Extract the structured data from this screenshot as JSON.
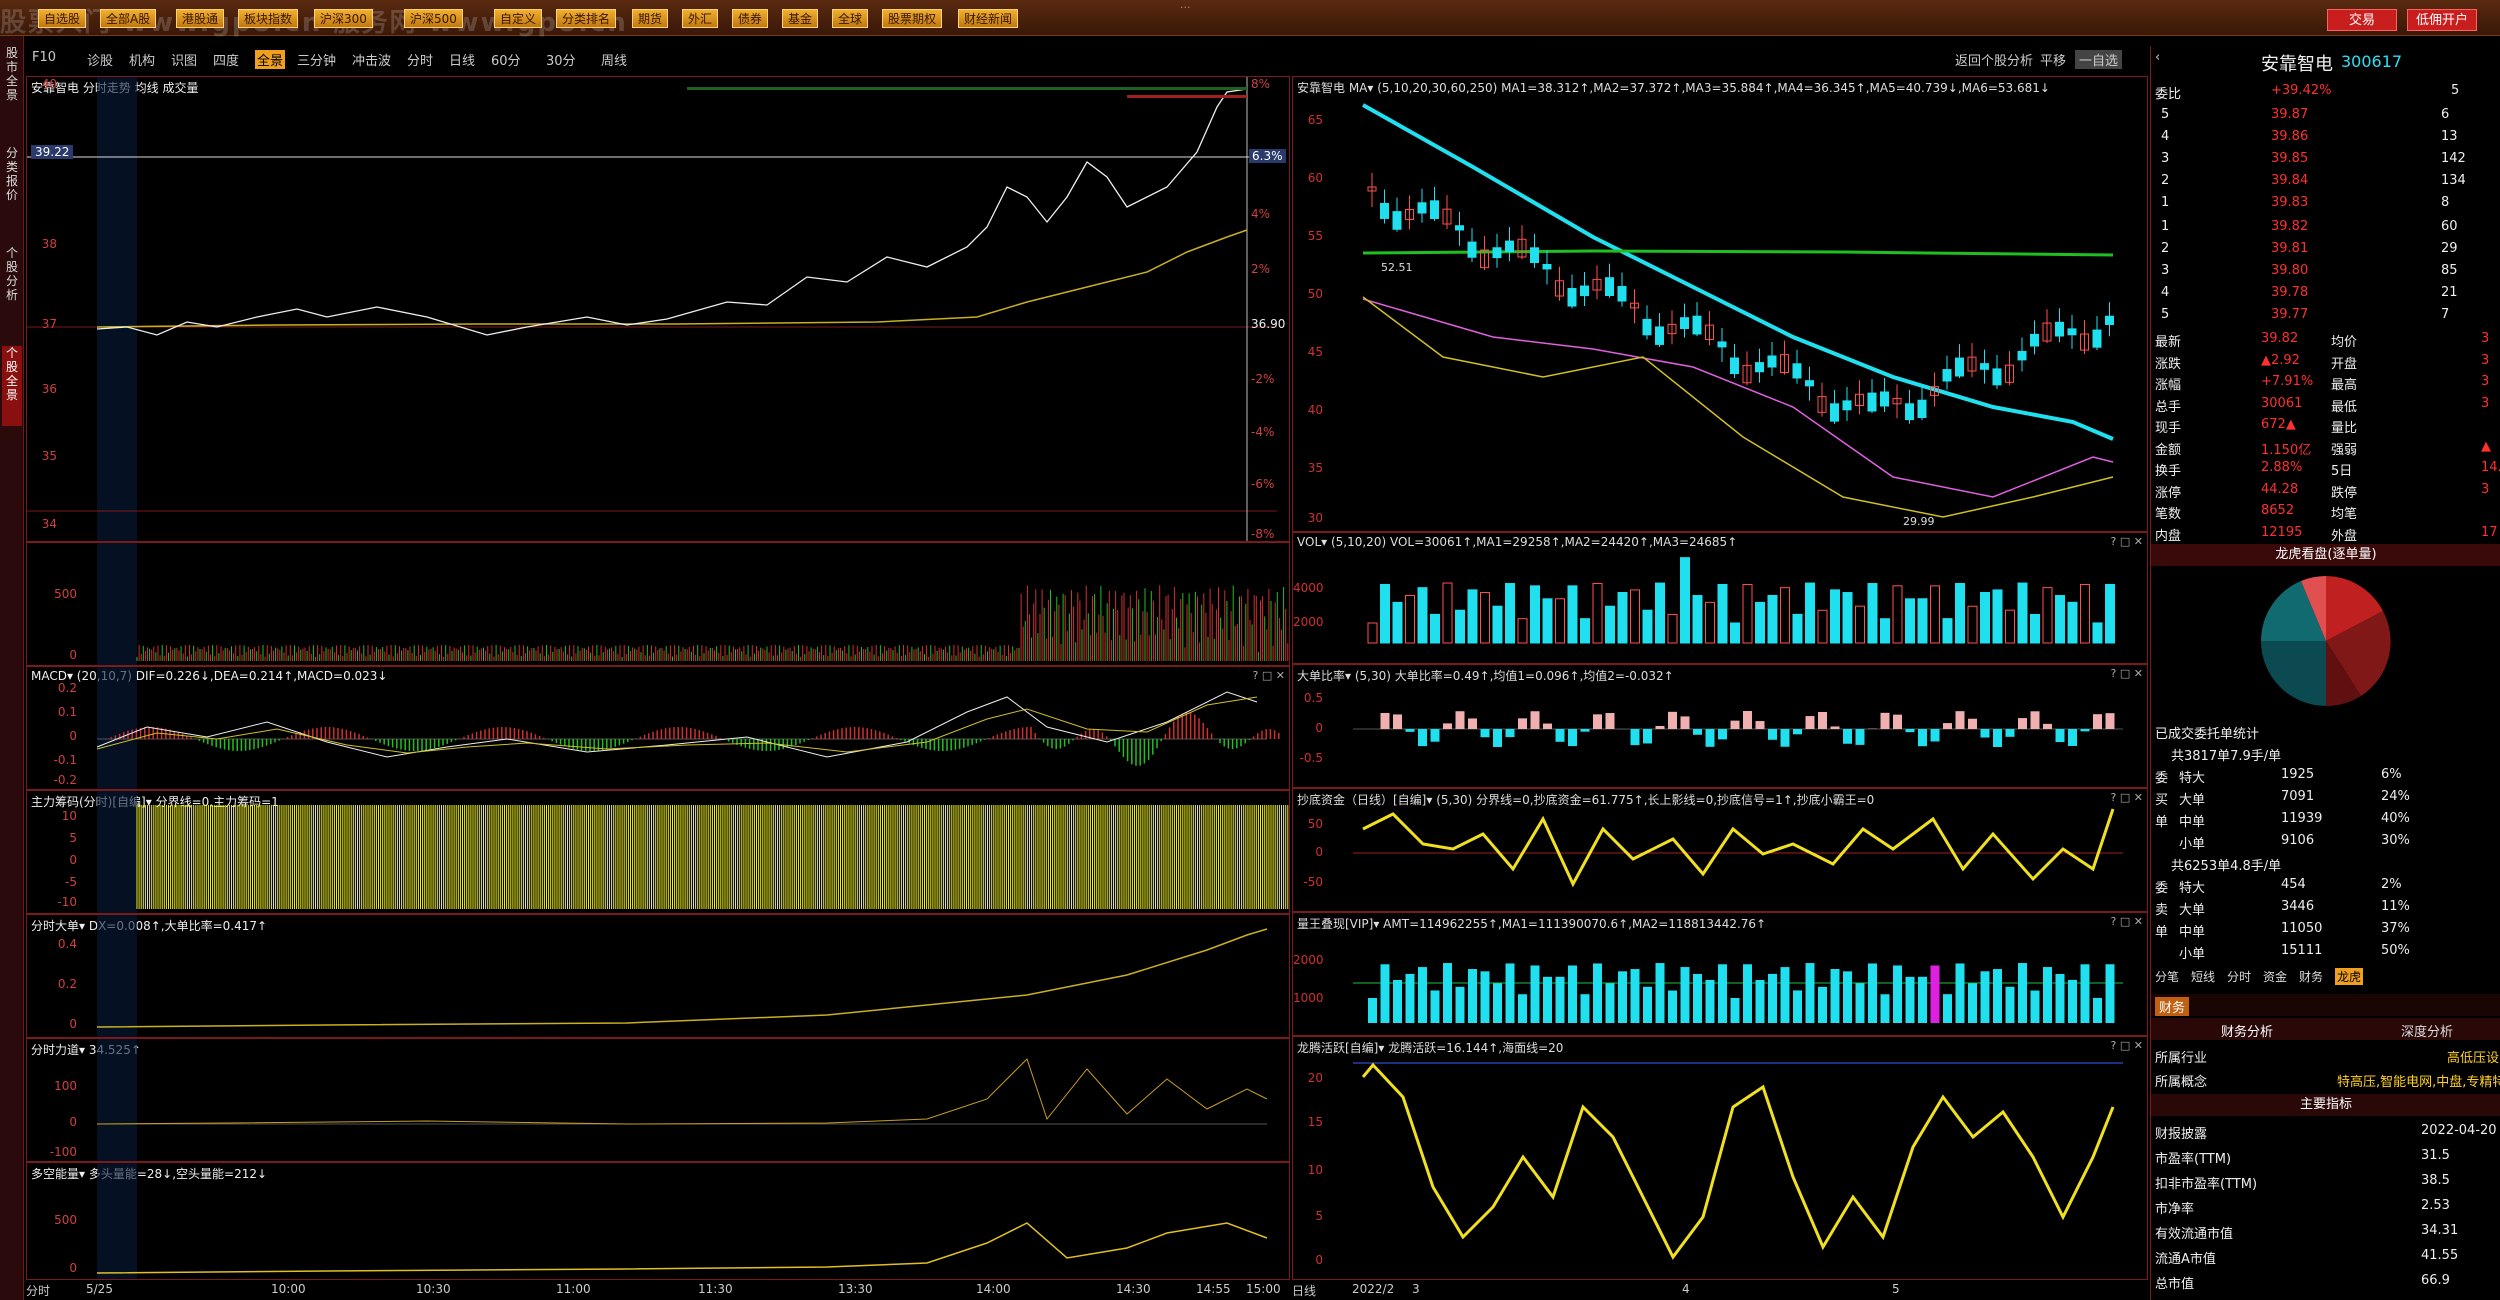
{
  "watermark": "股票入门 www.gp8.cn  服务网 www.gp8.cn",
  "window_title": "...",
  "toolbar": {
    "buttons": [
      "自选股",
      "全部A股",
      "港股通",
      "板块指数",
      "沪深300",
      "沪深500",
      "自定义",
      "分类排名",
      "期货",
      "外汇",
      "债券",
      "基金",
      "全球",
      "股票期权",
      "财经新闻"
    ],
    "trade_label": "交易",
    "account_label": "低佣开户"
  },
  "left_tabs": [
    {
      "label": "股市全景",
      "selected": false
    },
    {
      "label": "分类报价",
      "selected": false
    },
    {
      "label": "个股分析",
      "selected": false
    },
    {
      "label": "个股全景",
      "selected": true
    }
  ],
  "menubar": {
    "items": [
      "F10",
      "诊股",
      "机构",
      "识图",
      "四度",
      "全景",
      "三分钟",
      "冲击波",
      "分时",
      "日线",
      "60分",
      "30分",
      "周线"
    ],
    "active": "全景",
    "right_items": [
      "返回个股分析",
      "平移",
      "一自选"
    ]
  },
  "intraday": {
    "title": "安靠智电  分时走势  均线  成交量",
    "prices": [
      "40",
      "39",
      "38",
      "37",
      "36",
      "35",
      "34"
    ],
    "current_price": "39.22",
    "pct": [
      "8%",
      "6.3%",
      "4%",
      "2%",
      "36.90",
      "-2%",
      "-4%",
      "-6%",
      "-8%"
    ],
    "vol_ticks": [
      "500",
      "0"
    ],
    "macd_title": "MACD▾  (20,10,7)  DIF=0.226↓,DEA=0.214↑,MACD=0.023↓",
    "macd_ticks": [
      "0.2",
      "0.1",
      "0",
      "-0.1",
      "-0.2"
    ],
    "chip_title": "主力筹码(分时)[自编]▾  分界线=0,主力筹码=1",
    "chip_ticks": [
      "10",
      "5",
      "0",
      "-5",
      "-10"
    ],
    "bigorder_title": "分时大单▾  DX=0.008↑,大单比率=0.417↑",
    "bigorder_ticks": [
      "0.4",
      "0.2",
      "0"
    ],
    "power_title": "分时力道▾  34.525↑",
    "power_ticks": [
      "100",
      "0",
      "-100"
    ],
    "energy_title": "多空能量▾  多头量能=28↓,空头量能=212↓",
    "energy_ticks": [
      "500",
      "0"
    ],
    "time_axis": [
      "分时",
      "5/25",
      "10:00",
      "10:30",
      "11:00",
      "11:30",
      "13:30",
      "14:00",
      "14:30",
      "14:55",
      "15:00"
    ]
  },
  "daily": {
    "title": "安靠智电  MA▾  (5,10,20,30,60,250)  MA1=38.312↑,MA2=37.372↑,MA3=35.884↑,MA4=36.345↑,MA5=40.739↓,MA6=53.681↓",
    "price_ticks": [
      "65",
      "60",
      "55",
      "50",
      "45",
      "40",
      "35",
      "30"
    ],
    "hi_label": "52.51",
    "lo_label": "29.99",
    "vol_title": "VOL▾  (5,10,20)  VOL=30061↑,MA1=29258↑,MA2=24420↑,MA3=24685↑",
    "vol_ticks": [
      "4000",
      "2000"
    ],
    "ratio_title": "大单比率▾  (5,30)  大单比率=0.49↑,均值1=0.096↑,均值2=-0.032↑",
    "ratio_ticks": [
      "0.5",
      "0",
      "-0.5"
    ],
    "bottom_title": "抄底资金（日线）[自编]▾  (5,30)  分界线=0,抄底资金=61.775↑,长上影线=0,抄底信号=1↑,抄底小霸王=0",
    "bottom_ticks": [
      "50",
      "0",
      "-50"
    ],
    "amount_title": "量王叠现[VIP]▾  AMT=114962255↑,MA1=111390070.6↑,MA2=118813442.76↑",
    "amount_ticks": [
      "2000",
      "1000"
    ],
    "dragon_title": "龙腾活跃[自编]▾  龙腾活跃=16.144↑,海面线=20",
    "dragon_ticks": [
      "20",
      "15",
      "10",
      "5",
      "0"
    ],
    "time_axis": [
      "日线",
      "2022/2",
      "3",
      "4",
      "5"
    ]
  },
  "side": {
    "name": "安靠智电",
    "code": "300617",
    "weibi_label": "委比",
    "weibi": "+39.42%",
    "weicha": "5",
    "asks": [
      {
        "lvl": "5",
        "price": "39.87",
        "vol": "6"
      },
      {
        "lvl": "4",
        "price": "39.86",
        "vol": "13"
      },
      {
        "lvl": "3",
        "price": "39.85",
        "vol": "142"
      },
      {
        "lvl": "2",
        "price": "39.84",
        "vol": "134"
      },
      {
        "lvl": "1",
        "price": "39.83",
        "vol": "8"
      }
    ],
    "bids": [
      {
        "lvl": "1",
        "price": "39.82",
        "vol": "60"
      },
      {
        "lvl": "2",
        "price": "39.81",
        "vol": "29"
      },
      {
        "lvl": "3",
        "price": "39.80",
        "vol": "85"
      },
      {
        "lvl": "4",
        "price": "39.78",
        "vol": "21"
      },
      {
        "lvl": "5",
        "price": "39.77",
        "vol": "7"
      }
    ],
    "stats": [
      {
        "k1": "最新",
        "v1": "39.82",
        "k2": "均价",
        "v2": "3"
      },
      {
        "k1": "涨跌",
        "v1": "▲2.92",
        "k2": "开盘",
        "v2": "3"
      },
      {
        "k1": "涨幅",
        "v1": "+7.91%",
        "k2": "最高",
        "v2": "3"
      },
      {
        "k1": "总手",
        "v1": "30061",
        "k2": "最低",
        "v2": "3"
      },
      {
        "k1": "现手",
        "v1": "672▲",
        "k2": "量比",
        "v2": ""
      },
      {
        "k1": "金额",
        "v1": "1.150亿",
        "k2": "强弱",
        "v2": "▲"
      },
      {
        "k1": "换手",
        "v1": "2.88%",
        "k2": "5日",
        "v2": "14."
      },
      {
        "k1": "涨停",
        "v1": "44.28",
        "k2": "跌停",
        "v2": "3"
      },
      {
        "k1": "笔数",
        "v1": "8652",
        "k2": "均笔",
        "v2": ""
      },
      {
        "k1": "内盘",
        "v1": "12195",
        "k2": "外盘",
        "v2": "17"
      }
    ],
    "pie_title": "龙虎看盘(逐单量)",
    "deal_title": "已成交委托单统计",
    "buy_header": "共3817单7.9手/单",
    "buy_rows": [
      {
        "k": "特大",
        "v": "1925",
        "p": "6%"
      },
      {
        "k": "大单",
        "v": "7091",
        "p": "24%"
      },
      {
        "k": "中单",
        "v": "11939",
        "p": "40%"
      },
      {
        "k": "小单",
        "v": "9106",
        "p": "30%"
      }
    ],
    "sell_header": "共6253单4.8手/单",
    "sell_rows": [
      {
        "k": "特大",
        "v": "454",
        "p": "2%"
      },
      {
        "k": "大单",
        "v": "3446",
        "p": "11%"
      },
      {
        "k": "中单",
        "v": "11050",
        "p": "37%"
      },
      {
        "k": "小单",
        "v": "15111",
        "p": "50%"
      }
    ],
    "buy_side": [
      "委",
      "买",
      "单"
    ],
    "sell_side": [
      "委",
      "卖",
      "单"
    ],
    "tabs": [
      "分笔",
      "短线",
      "分时",
      "资金",
      "财务",
      "龙虎"
    ],
    "active_tab": "龙虎",
    "fin_label": "财务",
    "fin_tabs": [
      "财务分析",
      "深度分析"
    ],
    "industry_k": "所属行业",
    "industry_v": "高低压设",
    "concept_k": "所属概念",
    "concept_v": "特高压,智能电网,中盘,专精特",
    "main_index": "主要指标",
    "indicators": [
      {
        "k": "财报披露",
        "v": "2022-04-20"
      },
      {
        "k": "市盈率(TTM)",
        "v": "31.5"
      },
      {
        "k": "扣非市盈率(TTM)",
        "v": "38.5"
      },
      {
        "k": "市净率",
        "v": "2.53"
      },
      {
        "k": "有效流通市值",
        "v": "34.31"
      },
      {
        "k": "流通A市值",
        "v": "41.55"
      },
      {
        "k": "总市值",
        "v": "66.9"
      }
    ]
  }
}
